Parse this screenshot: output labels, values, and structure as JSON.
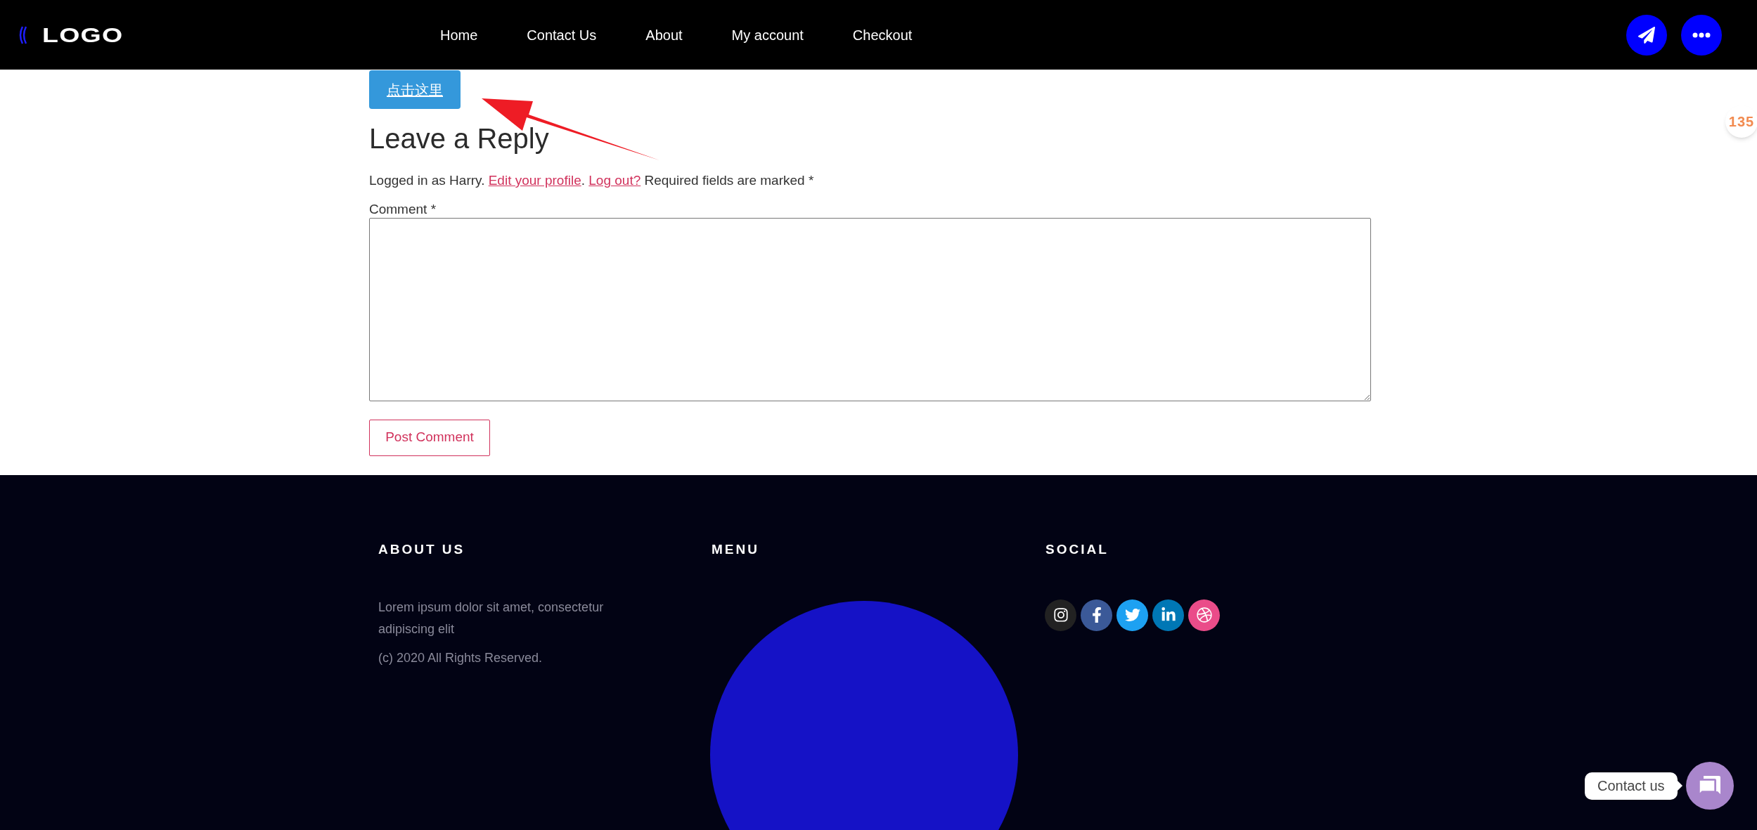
{
  "header": {
    "logo": "LOGO",
    "nav": [
      "Home",
      "Contact Us",
      "About",
      "My account",
      "Checkout"
    ]
  },
  "side_badge": "135",
  "cta_button": "点击这里",
  "reply": {
    "heading": "Leave a Reply",
    "notice_before": "Logged in as Harry. ",
    "edit_link": "Edit your profile",
    "separator": ". ",
    "logout_link": "Log out?",
    "notice_after": " Required fields are marked *",
    "comment_label": "Comment *",
    "submit": "Post Comment"
  },
  "footer": {
    "about": {
      "heading": "ABOUT US",
      "text": "Lorem ipsum dolor sit amet, consectetur adipiscing elit",
      "copyright": "(c) 2020 All Rights Reserved."
    },
    "menu": {
      "heading": "MENU"
    },
    "social": {
      "heading": "SOCIAL",
      "links": [
        {
          "kind": "instagram",
          "color": "#222222"
        },
        {
          "kind": "facebook",
          "color": "#3b5998"
        },
        {
          "kind": "twitter",
          "color": "#1da1f2"
        },
        {
          "kind": "linkedin",
          "color": "#0077b5"
        },
        {
          "kind": "dribbble",
          "color": "#ea4c89"
        }
      ]
    }
  },
  "chat": {
    "label": "Contact us"
  }
}
